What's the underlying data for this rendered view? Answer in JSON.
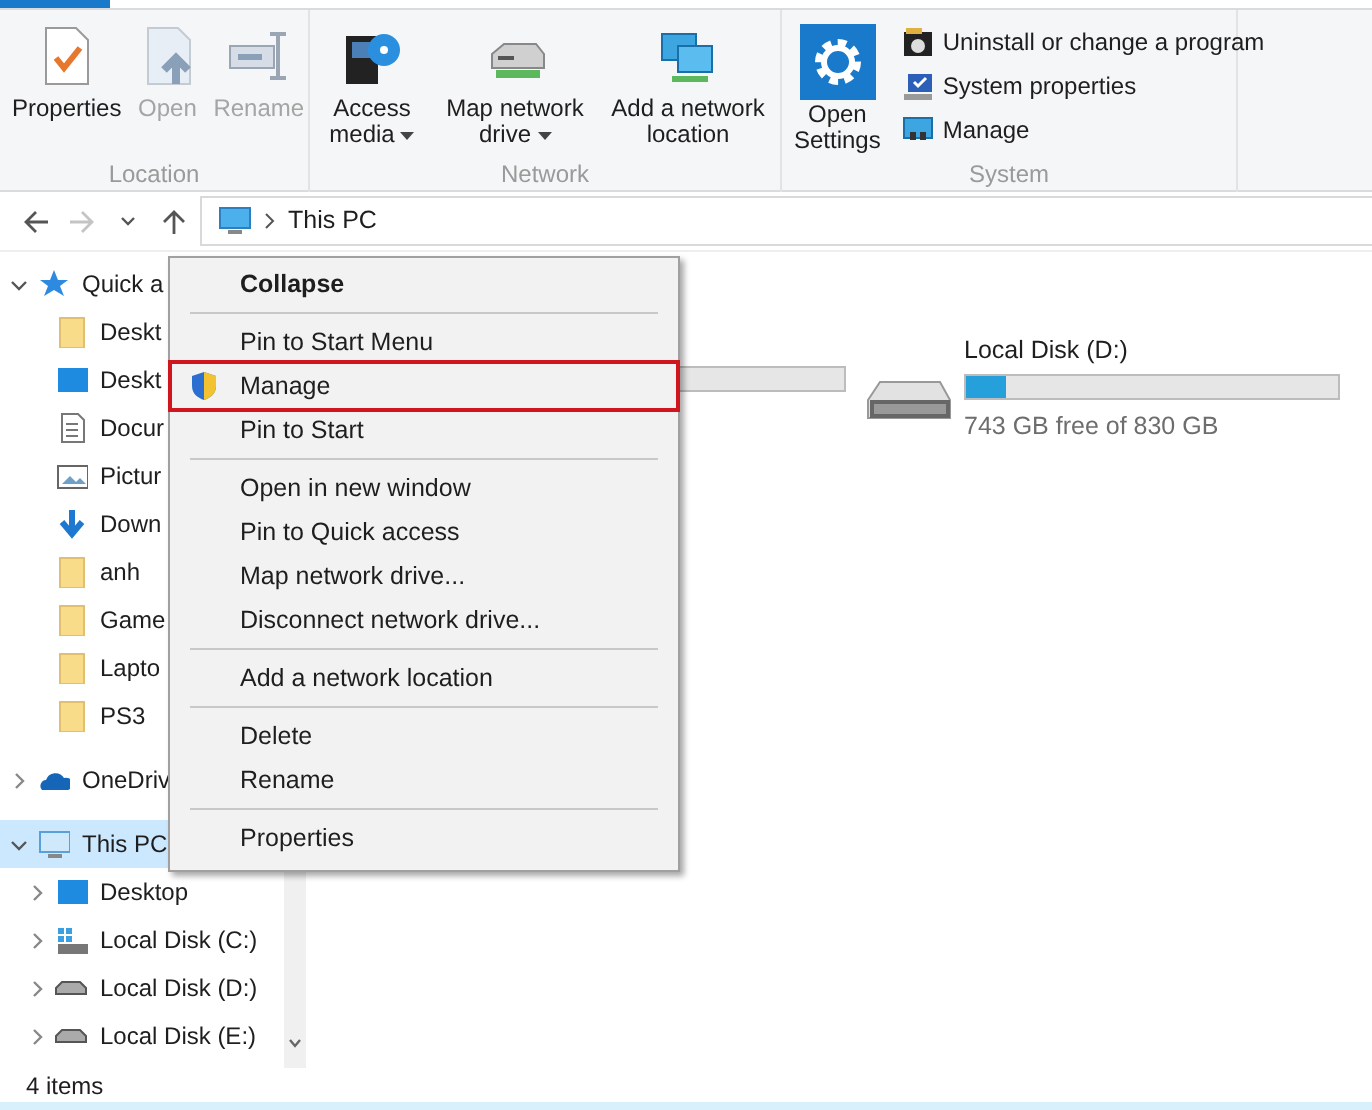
{
  "ribbon": {
    "groups": [
      {
        "label": "Location",
        "buttons": [
          {
            "label": "Properties",
            "disabled": false,
            "dropdown": false
          },
          {
            "label": "Open",
            "disabled": true,
            "dropdown": false
          },
          {
            "label": "Rename",
            "disabled": true,
            "dropdown": false
          }
        ]
      },
      {
        "label": "Network",
        "buttons": [
          {
            "label": "Access media",
            "disabled": false,
            "dropdown": true
          },
          {
            "label": "Map network drive",
            "disabled": false,
            "dropdown": true
          },
          {
            "label": "Add a network location",
            "disabled": false,
            "dropdown": false
          }
        ]
      },
      {
        "label": "System",
        "buttons": [
          {
            "label": "Open Settings",
            "disabled": false,
            "dropdown": false
          }
        ],
        "small_buttons": [
          {
            "label": "Uninstall or change a program"
          },
          {
            "label": "System properties"
          },
          {
            "label": "Manage"
          }
        ]
      }
    ]
  },
  "address": {
    "nav": [
      {
        "kind": "back",
        "disabled": false
      },
      {
        "kind": "forward",
        "disabled": true
      },
      {
        "kind": "recent",
        "disabled": false
      },
      {
        "kind": "up",
        "disabled": false
      }
    ],
    "path": [
      "This PC"
    ]
  },
  "sidebar": {
    "items": [
      {
        "label": "Quick a",
        "kind": "star",
        "expanded": true,
        "selected": false,
        "children": [
          {
            "label": "Deskt",
            "kind": "folder",
            "selected": false
          },
          {
            "label": "Deskt",
            "kind": "desktop",
            "selected": false
          },
          {
            "label": "Docur",
            "kind": "document",
            "selected": false
          },
          {
            "label": "Pictur",
            "kind": "pictures",
            "selected": false
          },
          {
            "label": "Down",
            "kind": "download",
            "selected": false
          },
          {
            "label": "anh",
            "kind": "folder",
            "selected": false
          },
          {
            "label": "Game",
            "kind": "folder",
            "selected": false
          },
          {
            "label": "Lapto",
            "kind": "folder",
            "selected": false
          },
          {
            "label": "PS3",
            "kind": "folder",
            "selected": false
          }
        ]
      },
      {
        "label": "OneDriv",
        "kind": "cloud",
        "expanded": false,
        "selected": false
      },
      {
        "label": "This PC",
        "kind": "pc",
        "expanded": true,
        "selected": true,
        "children": [
          {
            "label": "Desktop",
            "kind": "desktop",
            "expanded": false,
            "selected": false
          },
          {
            "label": "Local Disk (C:)",
            "kind": "windrive",
            "expanded": false,
            "selected": false
          },
          {
            "label": "Local Disk (D:)",
            "kind": "drive",
            "expanded": false,
            "selected": false
          },
          {
            "label": "Local Disk (E:)",
            "kind": "drive",
            "expanded": false,
            "selected": false
          }
        ]
      }
    ]
  },
  "drives": [
    {
      "name": "Local Disk (D:)",
      "level": 0.105,
      "free": "743 GB free of 830 GB"
    }
  ],
  "context_menu": {
    "groups": [
      {
        "items": [
          {
            "label": "Collapse",
            "kind": "plain",
            "default": true,
            "highlighted": false
          }
        ]
      },
      {
        "items": [
          {
            "label": "Pin to Start Menu",
            "kind": "plain",
            "default": false,
            "highlighted": false
          },
          {
            "label": "Manage",
            "kind": "shield",
            "default": false,
            "highlighted": true
          },
          {
            "label": "Pin to Start",
            "kind": "plain",
            "default": false,
            "highlighted": false
          }
        ]
      },
      {
        "items": [
          {
            "label": "Open in new window",
            "kind": "plain",
            "default": false,
            "highlighted": false
          },
          {
            "label": "Pin to Quick access",
            "kind": "plain",
            "default": false,
            "highlighted": false
          },
          {
            "label": "Map network drive...",
            "kind": "plain",
            "default": false,
            "highlighted": false
          },
          {
            "label": "Disconnect network drive...",
            "kind": "plain",
            "default": false,
            "highlighted": false
          }
        ]
      },
      {
        "items": [
          {
            "label": "Add a network location",
            "kind": "plain",
            "default": false,
            "highlighted": false
          }
        ]
      },
      {
        "items": [
          {
            "label": "Delete",
            "kind": "plain",
            "default": false,
            "highlighted": false
          },
          {
            "label": "Rename",
            "kind": "plain",
            "default": false,
            "highlighted": false
          }
        ]
      },
      {
        "items": [
          {
            "label": "Properties",
            "kind": "plain",
            "default": false,
            "highlighted": false
          }
        ]
      }
    ]
  },
  "status_bar": {
    "text": "4 items"
  }
}
